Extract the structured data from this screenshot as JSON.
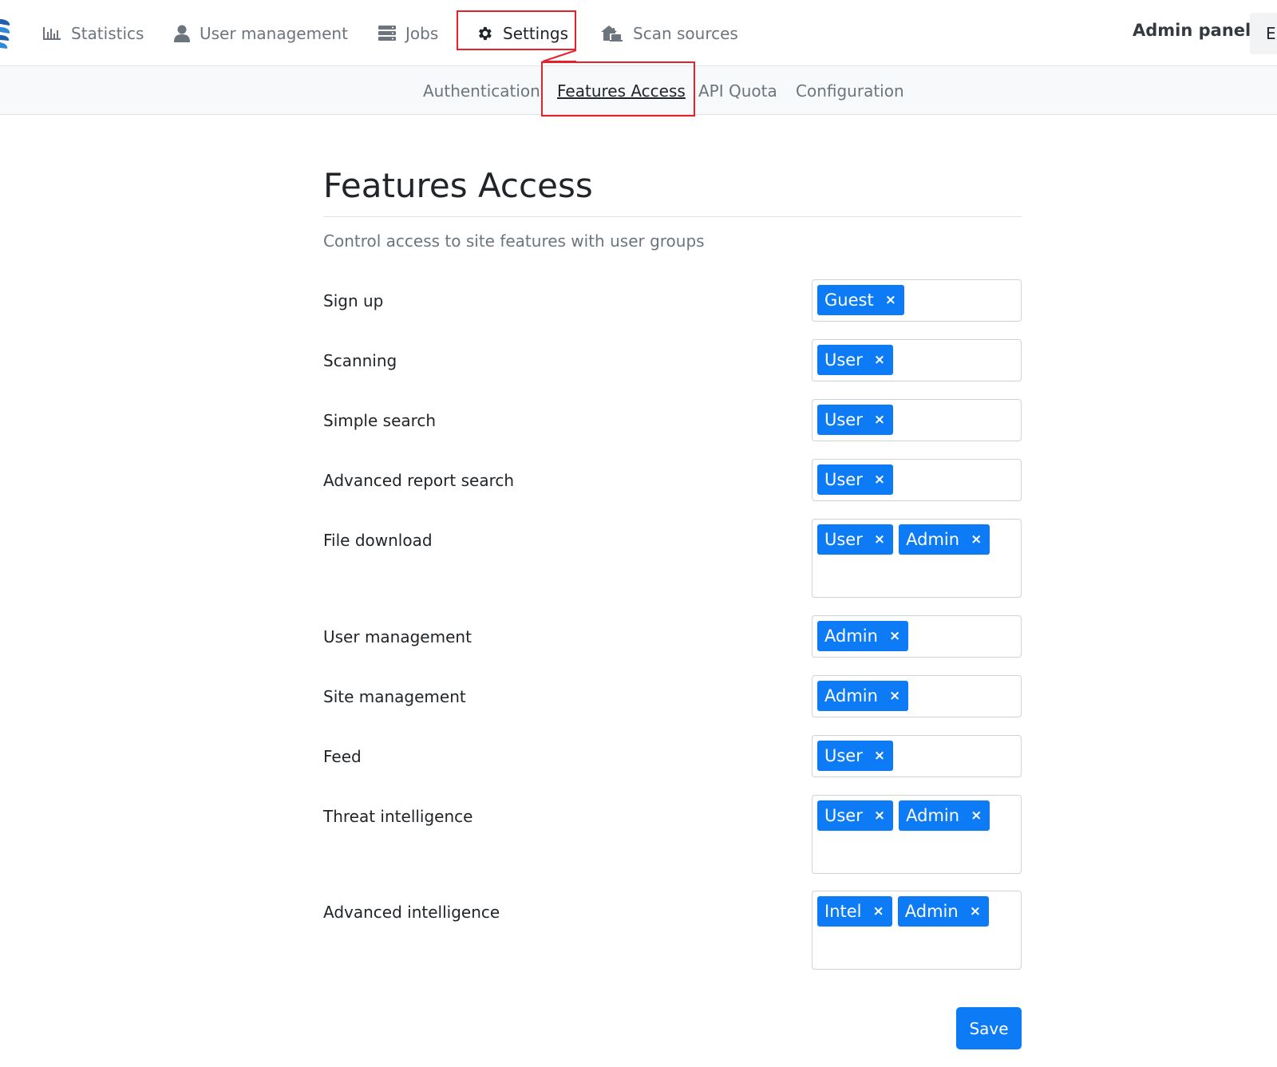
{
  "nav": {
    "items": [
      {
        "label": "Statistics",
        "icon": "bar-chart-icon"
      },
      {
        "label": "User management",
        "icon": "user-icon"
      },
      {
        "label": "Jobs",
        "icon": "server-icon"
      },
      {
        "label": "Settings",
        "icon": "gear-icon",
        "active": true
      },
      {
        "label": "Scan sources",
        "icon": "house-laptop-icon"
      }
    ],
    "admin_label": "Admin panel",
    "language": "EN"
  },
  "subnav": {
    "items": [
      {
        "label": "Authentication"
      },
      {
        "label": "Features Access",
        "active": true
      },
      {
        "label": "API Quota"
      },
      {
        "label": "Configuration"
      }
    ]
  },
  "page": {
    "title": "Features Access",
    "description": "Control access to site features with user groups"
  },
  "features": [
    {
      "label": "Sign up",
      "groups": [
        "Guest"
      ]
    },
    {
      "label": "Scanning",
      "groups": [
        "User"
      ]
    },
    {
      "label": "Simple search",
      "groups": [
        "User"
      ]
    },
    {
      "label": "Advanced report search",
      "groups": [
        "User"
      ]
    },
    {
      "label": "File download",
      "groups": [
        "User",
        "Admin"
      ]
    },
    {
      "label": "User management",
      "groups": [
        "Admin"
      ]
    },
    {
      "label": "Site management",
      "groups": [
        "Admin"
      ]
    },
    {
      "label": "Feed",
      "groups": [
        "User"
      ]
    },
    {
      "label": "Threat intelligence",
      "groups": [
        "User",
        "Admin"
      ]
    },
    {
      "label": "Advanced intelligence",
      "groups": [
        "Intel",
        "Admin"
      ]
    }
  ],
  "tag_remove_glyph": "×",
  "save_label": "Save",
  "colors": {
    "accent": "#0d7bf5",
    "highlight": "#e8202a",
    "muted_text": "#6c757d"
  }
}
